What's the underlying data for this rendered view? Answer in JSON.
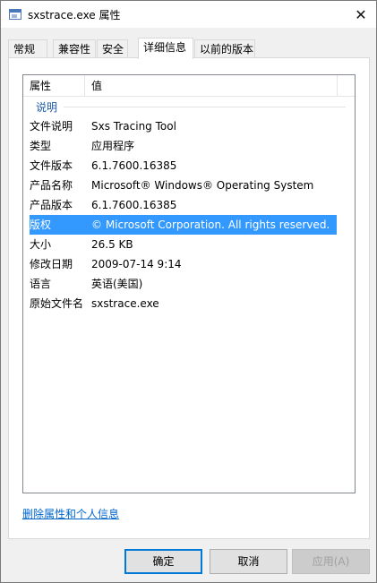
{
  "window": {
    "title": "sxstrace.exe 属性",
    "close_label": "✕"
  },
  "tabs": [
    {
      "label": "常规",
      "active": false
    },
    {
      "label": "兼容性",
      "active": false
    },
    {
      "label": "安全",
      "active": false
    },
    {
      "label": "详细信息",
      "active": true
    },
    {
      "label": "以前的版本",
      "active": false
    }
  ],
  "details": {
    "columns": [
      "属性",
      "值"
    ],
    "group": "说明",
    "rows": [
      {
        "key": "文件说明",
        "value": "Sxs Tracing Tool"
      },
      {
        "key": "类型",
        "value": "应用程序"
      },
      {
        "key": "文件版本",
        "value": "6.1.7600.16385"
      },
      {
        "key": "产品名称",
        "value": "Microsoft® Windows® Operating System"
      },
      {
        "key": "产品版本",
        "value": "6.1.7600.16385"
      },
      {
        "key": "版权",
        "value": "© Microsoft Corporation. All rights reserved.",
        "selected": true
      },
      {
        "key": "大小",
        "value": "26.5 KB"
      },
      {
        "key": "修改日期",
        "value": "2009-07-14 9:14"
      },
      {
        "key": "语言",
        "value": "英语(美国)"
      },
      {
        "key": "原始文件名",
        "value": "sxstrace.exe"
      }
    ],
    "remove_link": "删除属性和个人信息"
  },
  "buttons": {
    "ok": "确定",
    "cancel": "取消",
    "apply": "应用(A)"
  },
  "colors": {
    "selection": "#3399ff",
    "link": "#0066cc",
    "group_label": "#1e5aa8"
  }
}
